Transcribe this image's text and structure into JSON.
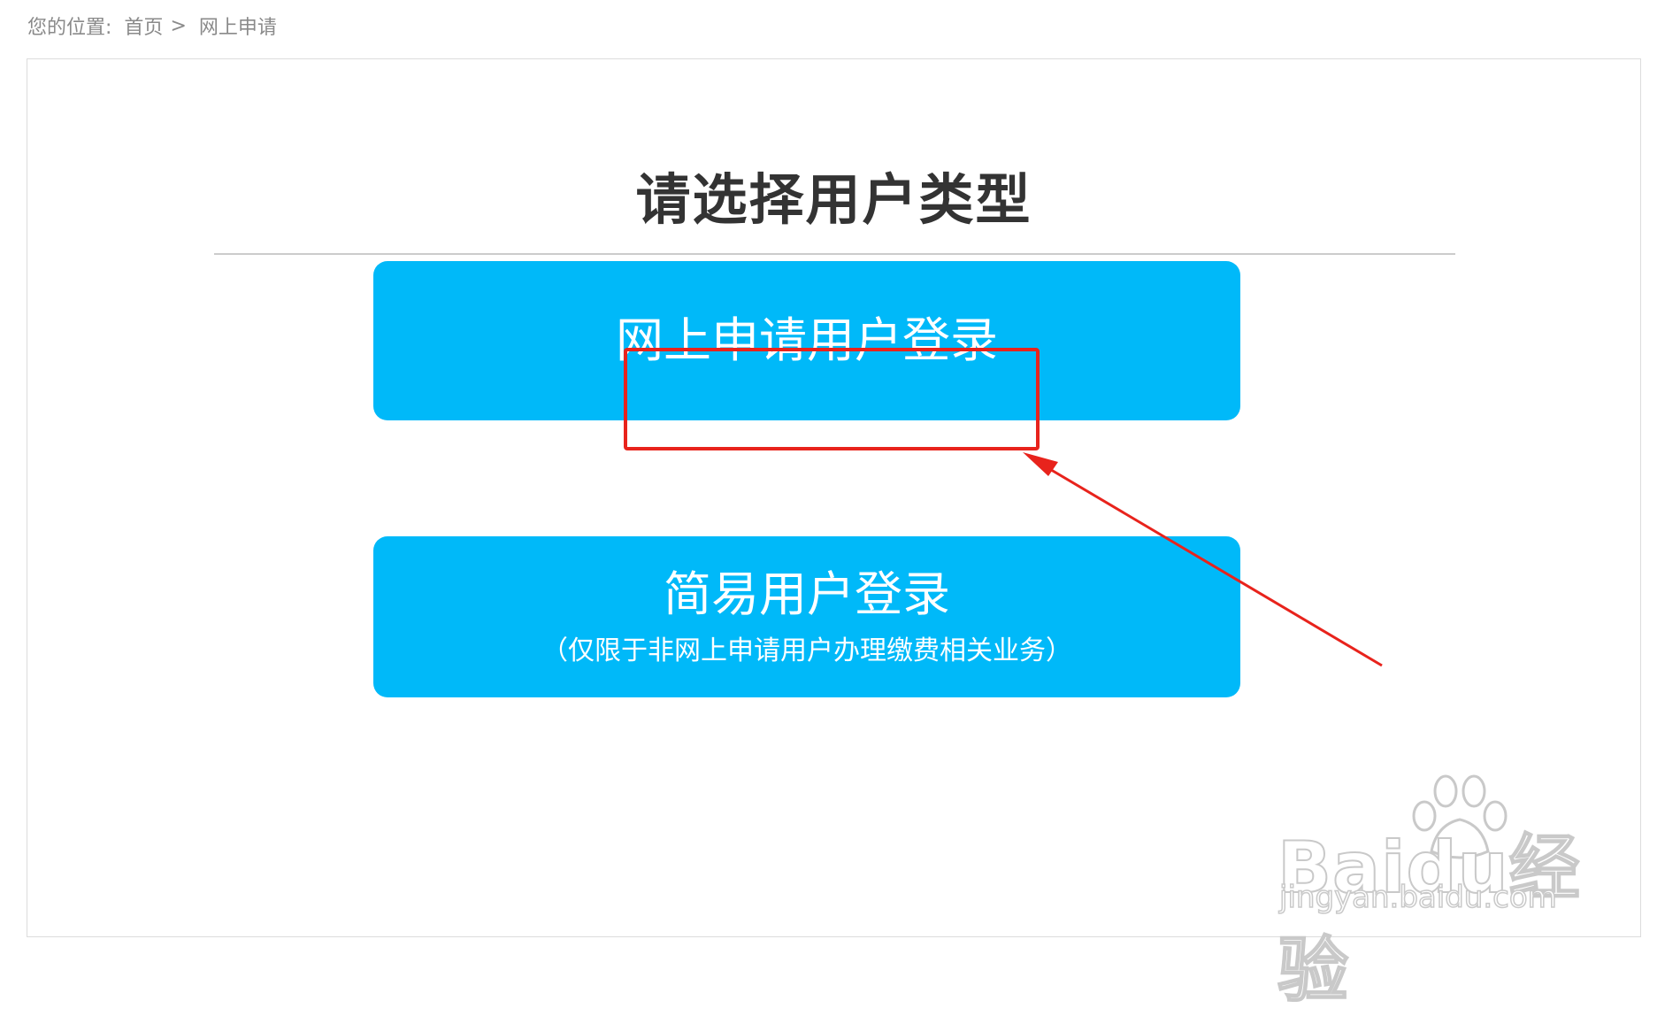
{
  "breadcrumb": {
    "prefix": "您的位置:",
    "home": "首页",
    "separator": ">",
    "current": "网上申请"
  },
  "page": {
    "title": "请选择用户类型"
  },
  "options": {
    "online": {
      "label": "网上申请用户登录"
    },
    "simple": {
      "label": "简易用户登录",
      "note": "（仅限于非网上申请用户办理缴费相关业务）"
    }
  },
  "watermark": {
    "brand": "Baidu经验",
    "url": "jingyan.baidu.com"
  },
  "colors": {
    "button_bg": "#00b9f9",
    "highlight": "#e8231c",
    "title": "#333333",
    "breadcrumb": "#8a8a8a"
  }
}
